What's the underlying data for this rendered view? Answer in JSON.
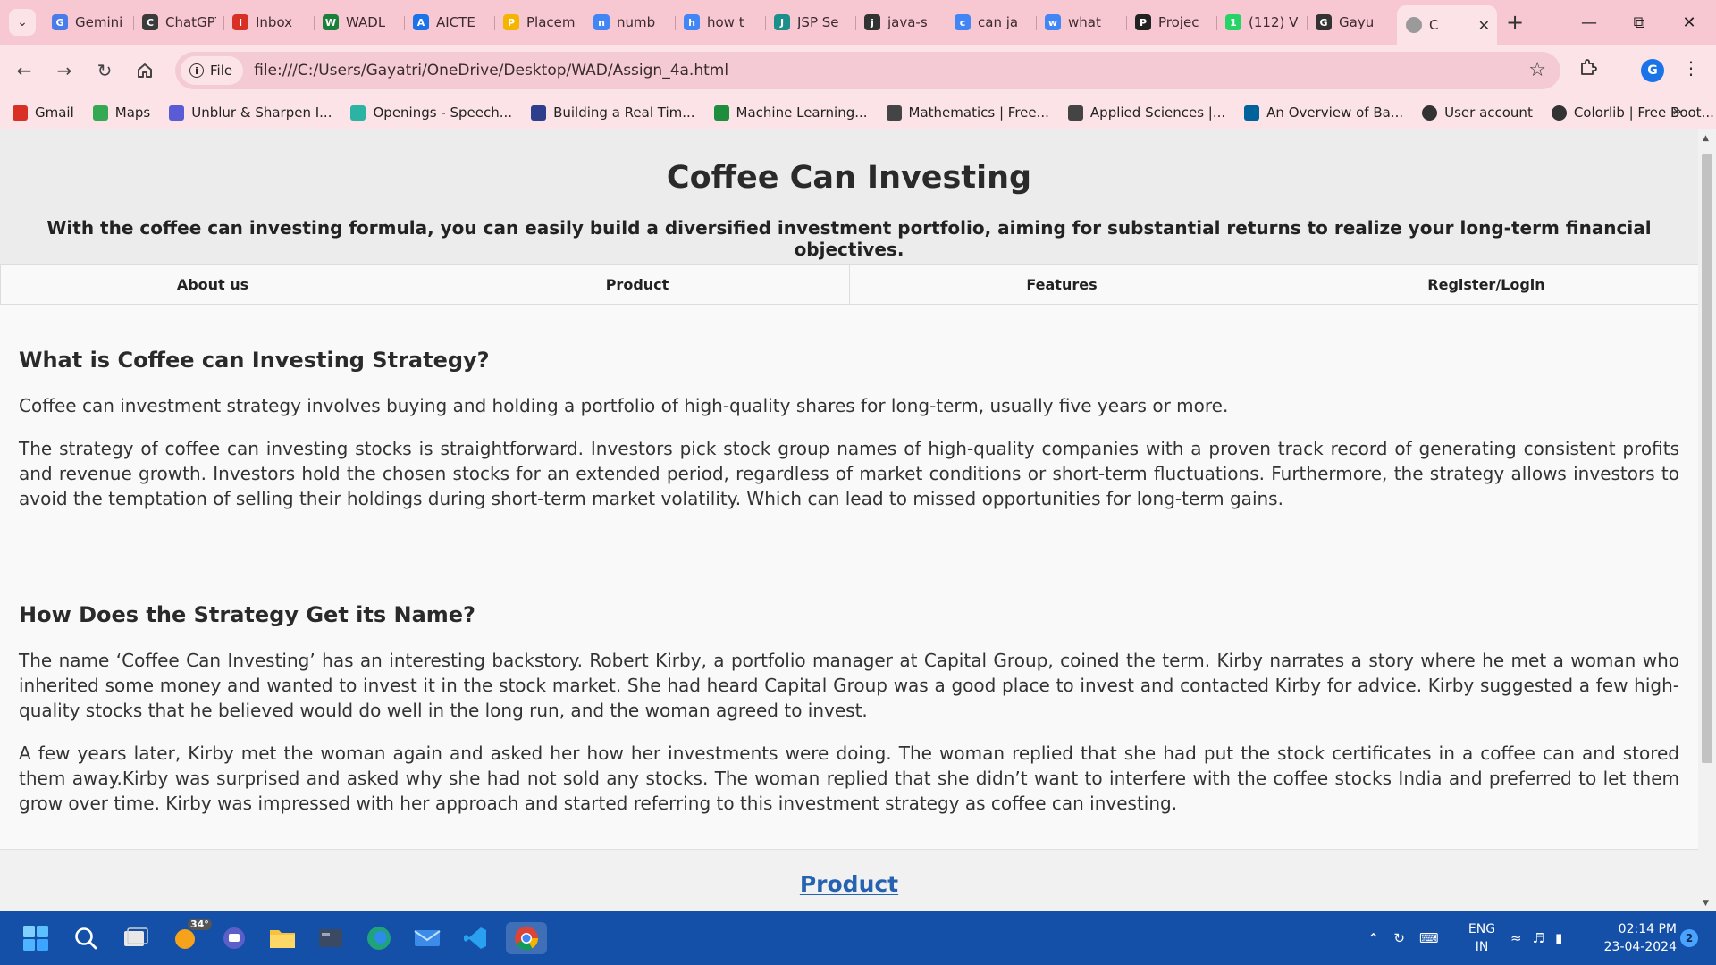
{
  "browser": {
    "tabs": [
      {
        "label": "Gemini",
        "icon": "gemini-icon",
        "color": "#4a7bea"
      },
      {
        "label": "ChatGPT",
        "icon": "chatgpt-icon",
        "color": "#3b3b3b"
      },
      {
        "label": "Inbox",
        "icon": "gmail-icon",
        "color": "#d93025"
      },
      {
        "label": "WADL",
        "icon": "sheets-icon",
        "color": "#188038"
      },
      {
        "label": "AICTE",
        "icon": "aicte-icon",
        "color": "#1a73e8"
      },
      {
        "label": "Placem",
        "icon": "drive-icon",
        "color": "#f4b400"
      },
      {
        "label": "numb",
        "icon": "google-icon",
        "color": "#4285f4"
      },
      {
        "label": "how t",
        "icon": "google-icon",
        "color": "#4285f4"
      },
      {
        "label": "JSP Se",
        "icon": "jsp-icon",
        "color": "#1c8f8a"
      },
      {
        "label": "java-s",
        "icon": "github-icon",
        "color": "#333333"
      },
      {
        "label": "can ja",
        "icon": "google-icon",
        "color": "#4285f4"
      },
      {
        "label": "what",
        "icon": "google-icon",
        "color": "#4285f4"
      },
      {
        "label": "Projec",
        "icon": "tumblr-icon",
        "color": "#222222"
      },
      {
        "label": "(112) V",
        "icon": "whatsapp-icon",
        "color": "#25d366"
      },
      {
        "label": "Gayu",
        "icon": "github-icon",
        "color": "#333333"
      }
    ],
    "active_tab": {
      "label": "C",
      "icon": "globe-icon"
    },
    "site_chip": "File",
    "url": "file:///C:/Users/Gayatri/OneDrive/Desktop/WAD/Assign_4a.html",
    "profile_initial": "G",
    "bookmarks": [
      {
        "label": "Gmail",
        "icon": "gmail-icon",
        "color": "#d93025"
      },
      {
        "label": "Maps",
        "icon": "maps-icon",
        "color": "#34a853"
      },
      {
        "label": "Unblur & Sharpen I...",
        "icon": "unblur-icon",
        "color": "#5b5bd6"
      },
      {
        "label": "Openings - Speech...",
        "icon": "speech-icon",
        "color": "#2bb3a3"
      },
      {
        "label": "Building a Real Tim...",
        "icon": "ids-icon",
        "color": "#2d3e8c"
      },
      {
        "label": "Machine Learning...",
        "icon": "check-icon",
        "color": "#1e8e3e"
      },
      {
        "label": "Mathematics | Free...",
        "icon": "lock-open-icon",
        "color": "#444444"
      },
      {
        "label": "Applied Sciences |...",
        "icon": "lock-open-icon",
        "color": "#444444"
      },
      {
        "label": "An Overview of Ba...",
        "icon": "ieee-icon",
        "color": "#00629b"
      },
      {
        "label": "User account",
        "icon": "globe-icon",
        "color": "#333333"
      },
      {
        "label": "Colorlib | Free Boot...",
        "icon": "globe-icon",
        "color": "#333333"
      }
    ]
  },
  "page": {
    "title": "Coffee Can Investing",
    "tagline": "With the coffee can investing formula, you can easily build a diversified investment portfolio, aiming for substantial returns to realize your long-term financial objectives.",
    "nav": [
      "About us",
      "Product",
      "Features",
      "Register/Login"
    ],
    "section1": {
      "heading": "What is Coffee can Investing Strategy?",
      "p1": "Coffee can investment strategy involves buying and holding a portfolio of high-quality shares for long-term, usually five years or more.",
      "p2": "The strategy of coffee can investing stocks is straightforward. Investors pick stock group names of high-quality companies with a proven track record of generating consistent profits and revenue growth. Investors hold the chosen stocks for an extended period, regardless of market conditions or short-term fluctuations. Furthermore, the strategy allows investors to avoid the temptation of selling their holdings during short-term market volatility. Which can lead to missed opportunities for long-term gains."
    },
    "section2": {
      "heading": "How Does the Strategy Get its Name?",
      "p1": "The name ‘Coffee Can Investing’ has an interesting backstory. Robert Kirby, a portfolio manager at Capital Group, coined the term. Kirby narrates a story where he met a woman who inherited some money and wanted to invest it in the stock market. She had heard Capital Group was a good place to invest and contacted Kirby for advice. Kirby suggested a few high-quality stocks that he believed would do well in the long run, and the woman agreed to invest.",
      "p2": "A few years later, Kirby met the woman again and asked her how her investments were doing. The woman replied that she had put the stock certificates in a coffee can and stored them away.Kirby was surprised and asked why she had not sold any stocks. The woman replied that she didn’t want to interfere with the coffee stocks India and preferred to let them grow over time. Kirby was impressed with her approach and started referring to this investment strategy as coffee can investing."
    },
    "product_link": "Product"
  },
  "taskbar": {
    "weather": "34°",
    "lang_line1": "ENG",
    "lang_line2": "IN",
    "time": "02:14 PM",
    "date": "23-04-2024",
    "notifications": "2"
  }
}
